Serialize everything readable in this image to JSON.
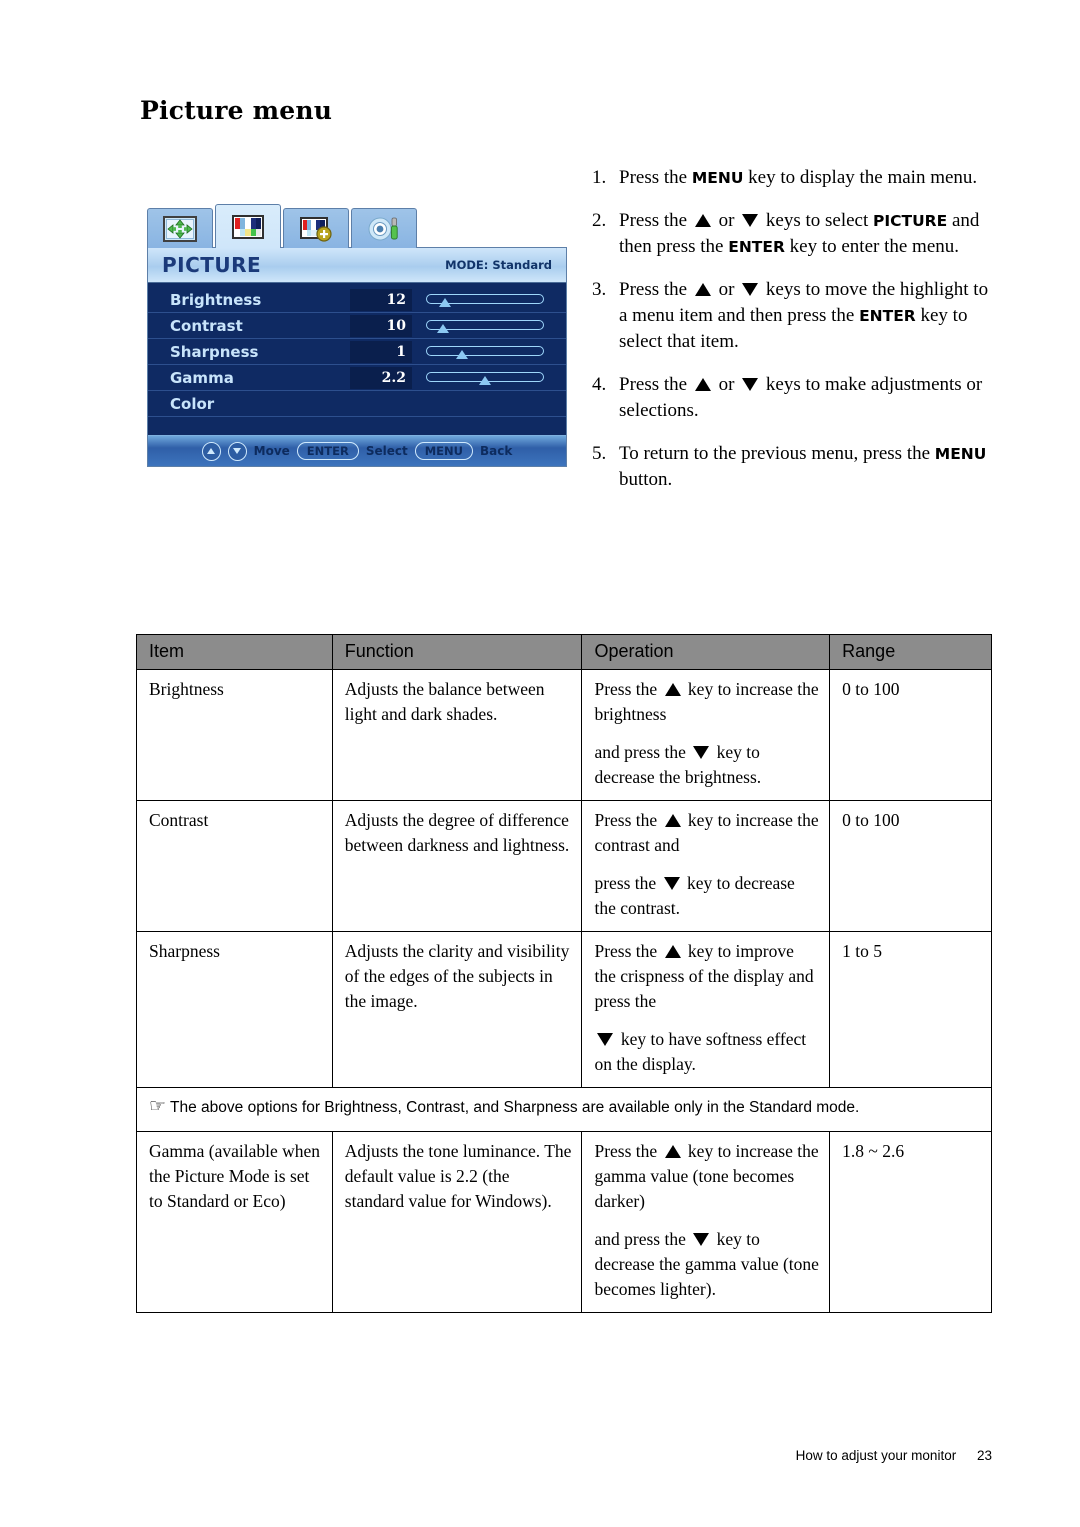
{
  "page": {
    "title": "Picture menu",
    "footer_text": "How to adjust your monitor",
    "footer_page": "23"
  },
  "osd": {
    "tabs": [
      {
        "name": "display-tab",
        "icon": "move-arrows-icon",
        "active": false
      },
      {
        "name": "picture-tab",
        "icon": "color-bars-icon",
        "active": true
      },
      {
        "name": "picture-advanced-tab",
        "icon": "color-bars-plus-icon",
        "active": false
      },
      {
        "name": "system-tab",
        "icon": "gear-screwdriver-icon",
        "active": false
      }
    ],
    "title": "PICTURE",
    "mode": "MODE: Standard",
    "items": [
      {
        "label": "Brightness",
        "value": "12",
        "slider_pct": 12
      },
      {
        "label": "Contrast",
        "value": "10",
        "slider_pct": 10
      },
      {
        "label": "Sharpness",
        "value": "1",
        "slider_pct": 28
      },
      {
        "label": "Gamma",
        "value": "2.2",
        "slider_pct": 50
      },
      {
        "label": "Color",
        "value": "",
        "slider_pct": null
      }
    ],
    "footer": {
      "move_label": "Move",
      "enter_label": "ENTER",
      "select_label": "Select",
      "menu_label": "MENU",
      "back_label": "Back"
    }
  },
  "steps": [
    {
      "num": "1.",
      "parts": [
        {
          "t": "Press the "
        },
        {
          "t": "MENU",
          "b": true
        },
        {
          "t": " key to display the main menu."
        }
      ]
    },
    {
      "num": "2.",
      "parts": [
        {
          "t": "Press the "
        },
        {
          "t": "",
          "tri": "up"
        },
        {
          "t": " or "
        },
        {
          "t": "",
          "tri": "down"
        },
        {
          "t": " keys to select "
        },
        {
          "t": "PICTURE",
          "b": true
        },
        {
          "t": " and then press the "
        },
        {
          "t": "ENTER",
          "b": true
        },
        {
          "t": " key to enter the menu."
        }
      ]
    },
    {
      "num": "3.",
      "parts": [
        {
          "t": "Press the "
        },
        {
          "t": "",
          "tri": "up"
        },
        {
          "t": " or "
        },
        {
          "t": "",
          "tri": "down"
        },
        {
          "t": " keys to move the highlight to a menu item and then press the "
        },
        {
          "t": "ENTER",
          "b": true
        },
        {
          "t": " key to select that item."
        }
      ]
    },
    {
      "num": "4.",
      "parts": [
        {
          "t": "Press the "
        },
        {
          "t": "",
          "tri": "up"
        },
        {
          "t": " or "
        },
        {
          "t": "",
          "tri": "down"
        },
        {
          "t": " keys to make adjustments or selections."
        }
      ]
    },
    {
      "num": "5.",
      "parts": [
        {
          "t": "To return to the previous menu, press the "
        },
        {
          "t": "MENU",
          "b": true
        },
        {
          "t": " button."
        }
      ]
    }
  ],
  "table": {
    "headers": [
      "Item",
      "Function",
      "Operation",
      "Range"
    ],
    "rows": [
      {
        "kind": "data",
        "item": "Brightness",
        "function": [
          "Adjusts the balance between light and dark shades."
        ],
        "operation": [
          [
            {
              "t": "Press the "
            },
            {
              "tri": "up"
            },
            {
              "t": " key to increase the brightness"
            }
          ],
          [
            {
              "t": "and press the "
            },
            {
              "tri": "down"
            },
            {
              "t": " key to decrease the brightness."
            }
          ]
        ],
        "range": "0 to 100"
      },
      {
        "kind": "data",
        "item": "Contrast",
        "function": [
          "Adjusts the degree of difference between darkness and lightness."
        ],
        "operation": [
          [
            {
              "t": "Press the "
            },
            {
              "tri": "up"
            },
            {
              "t": " key to increase the contrast and"
            }
          ],
          [
            {
              "t": "press the "
            },
            {
              "tri": "down"
            },
            {
              "t": " key to decrease the contrast."
            }
          ]
        ],
        "range": "0 to 100"
      },
      {
        "kind": "data",
        "item": "Sharpness",
        "function": [
          "Adjusts the clarity and visibility of the edges of the subjects in the image."
        ],
        "operation": [
          [
            {
              "t": "Press the "
            },
            {
              "tri": "up"
            },
            {
              "t": " key to improve the crispness of the display and press the"
            }
          ],
          [
            {
              "tri": "down"
            },
            {
              "t": " key to have softness effect on the display."
            }
          ]
        ],
        "range": "1 to 5"
      },
      {
        "kind": "note",
        "icon": "pointing-hand-icon",
        "note": "The above options for Brightness, Contrast, and Sharpness are available only in the Standard mode."
      },
      {
        "kind": "data",
        "item": "Gamma (available when the Picture Mode is set to Standard or Eco)",
        "function": [
          "Adjusts the tone luminance. The default value is 2.2 (the standard value for Windows)."
        ],
        "operation": [
          [
            {
              "t": "Press the "
            },
            {
              "tri": "up"
            },
            {
              "t": " key to increase the gamma value (tone becomes darker)"
            }
          ],
          [
            {
              "t": "and press the "
            },
            {
              "tri": "down"
            },
            {
              "t": " key to decrease the gamma value (tone becomes lighter)."
            }
          ]
        ],
        "range": "1.8 ~ 2.6"
      }
    ]
  },
  "colors": {
    "osd_body": "#0f2a63",
    "osd_header_light": "#cfe6fa",
    "osd_label": "#c8e4fb",
    "table_header_bg": "#8c8c8c"
  }
}
